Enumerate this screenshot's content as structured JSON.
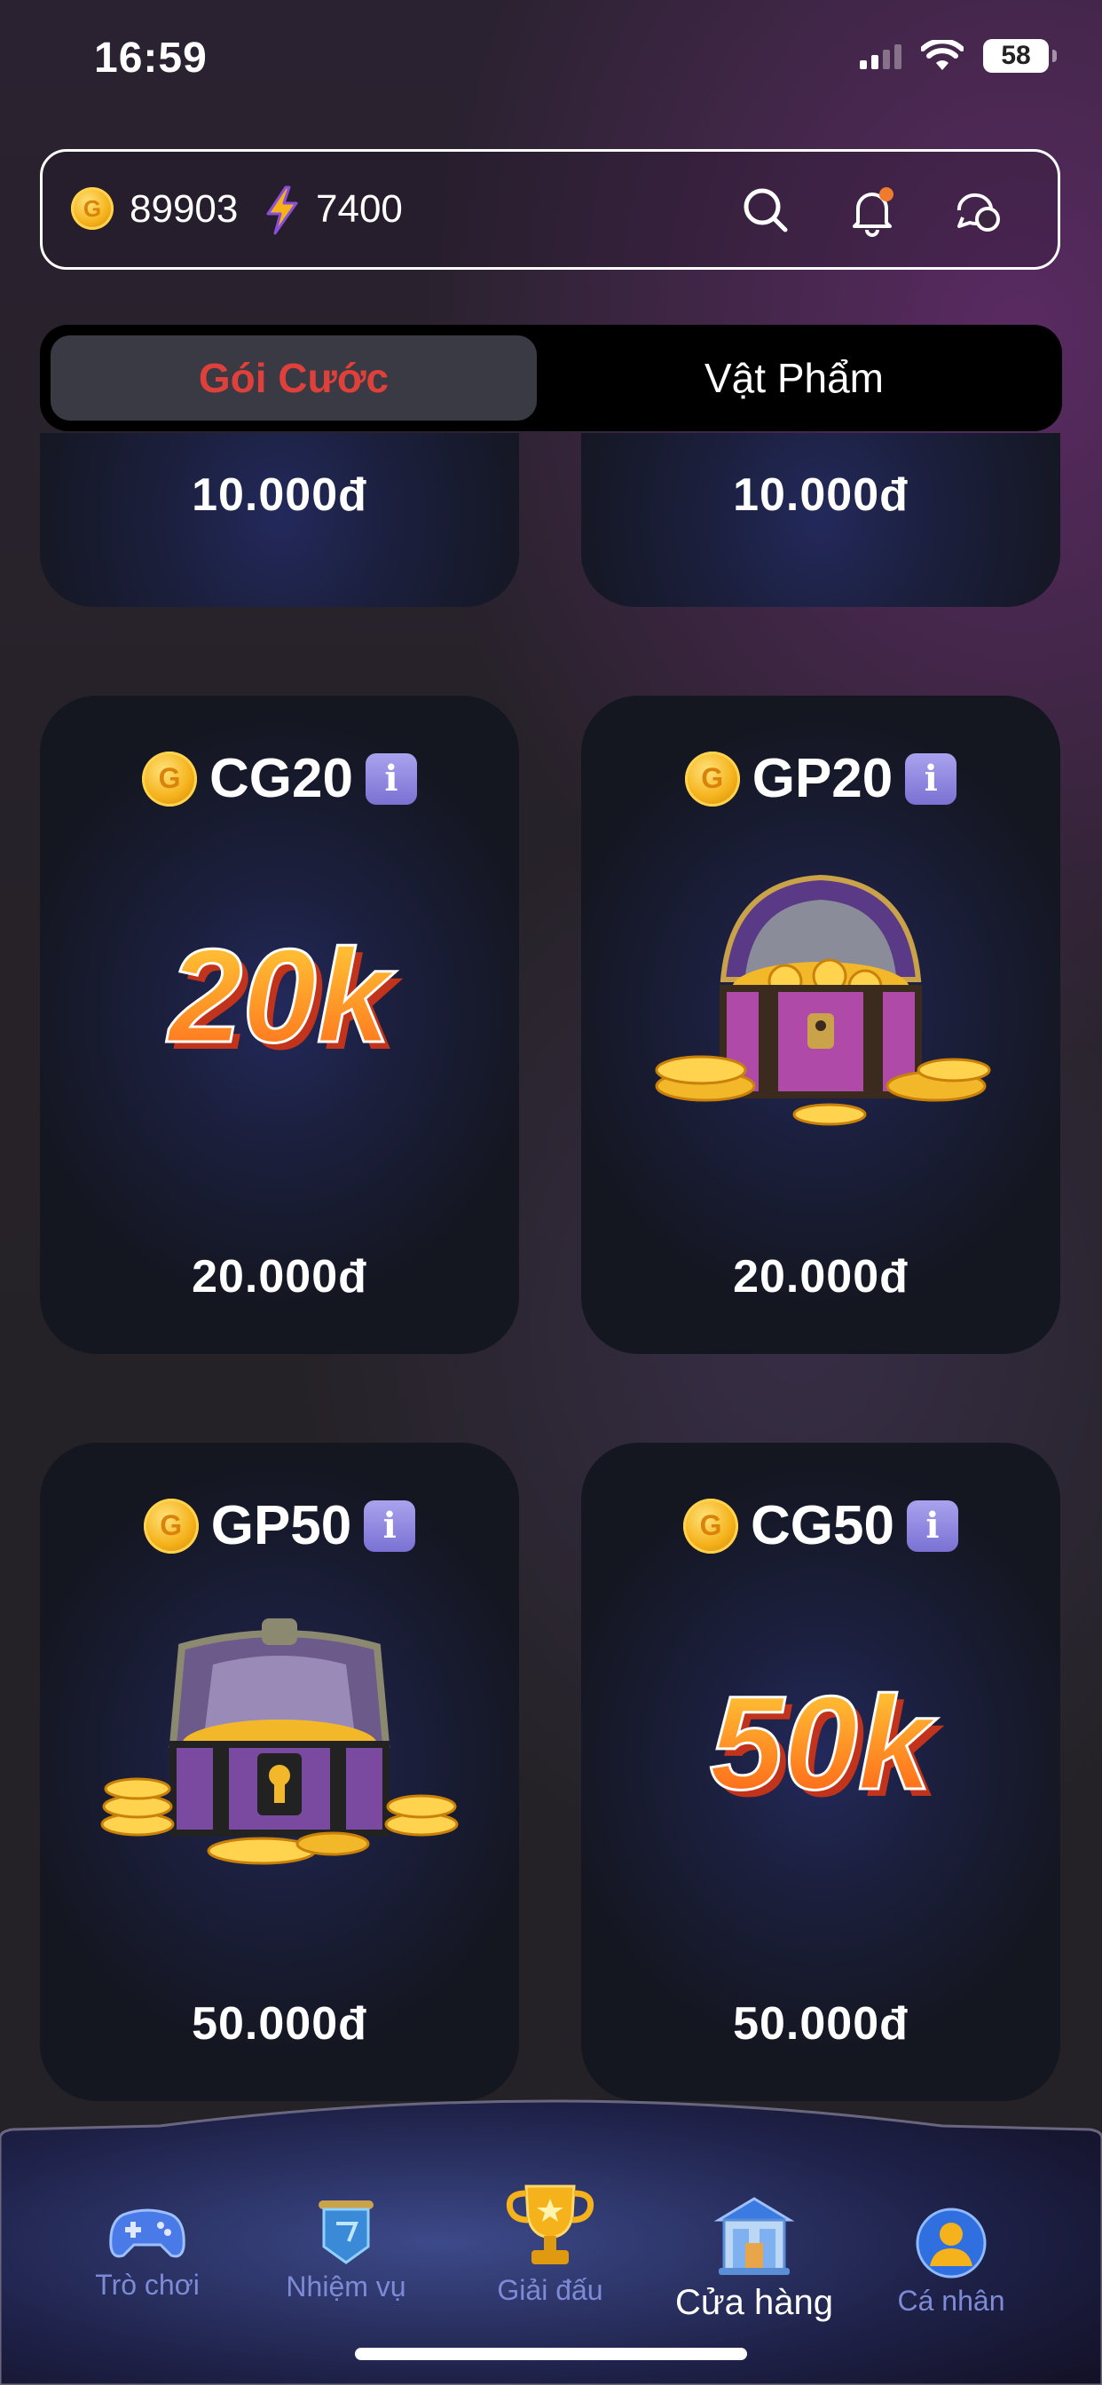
{
  "status_bar": {
    "time": "16:59",
    "battery": "58"
  },
  "header": {
    "coins": "89903",
    "energy": "7400"
  },
  "tabs": [
    {
      "label": "Gói Cước",
      "active": true
    },
    {
      "label": "Vật Phẩm",
      "active": false
    }
  ],
  "partial_cards": [
    {
      "price": "10.000đ"
    },
    {
      "price": "10.000đ"
    }
  ],
  "cards": [
    {
      "name": "CG20",
      "art_text": "20k",
      "price": "20.000đ"
    },
    {
      "name": "GP20",
      "art": "treasure-chest",
      "price": "20.000đ"
    },
    {
      "name": "GP50",
      "art": "treasure-chest-large",
      "price": "50.000đ"
    },
    {
      "name": "CG50",
      "art_text": "50k",
      "price": "50.000đ"
    }
  ],
  "nav": [
    {
      "label": "Trò chơi",
      "icon": "gamepad-icon"
    },
    {
      "label": "Nhiệm vụ",
      "icon": "quest-banner-icon"
    },
    {
      "label": "Giải đấu",
      "icon": "trophy-icon"
    },
    {
      "label": "Cửa hàng",
      "icon": "shop-icon",
      "active": true
    },
    {
      "label": "Cá nhân",
      "icon": "profile-icon"
    }
  ],
  "colors": {
    "accent_red": "#e0403a",
    "nav_label": "#7d8bd6",
    "info_purple": "#8f87e0"
  }
}
